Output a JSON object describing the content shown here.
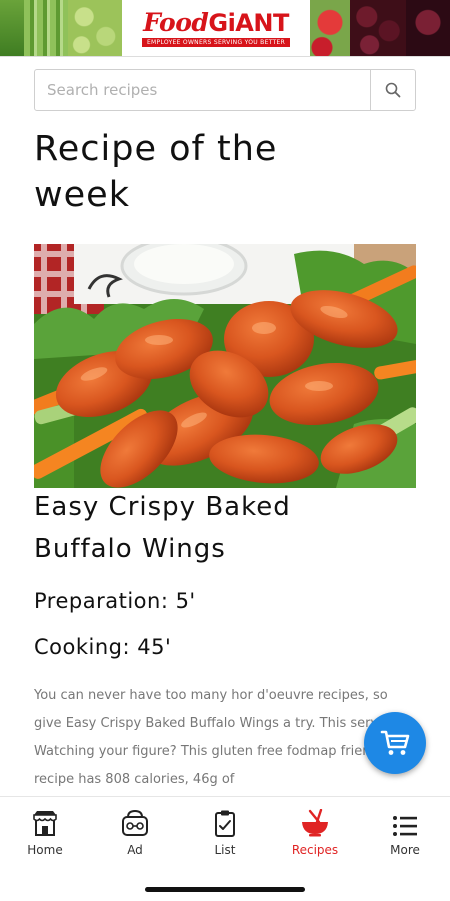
{
  "header": {
    "logo_text_part1": "Food",
    "logo_text_part2": "GiANT",
    "logo_tagline": "EMPLOYEE OWNERS SERVING YOU BETTER"
  },
  "search": {
    "placeholder": "Search recipes",
    "value": ""
  },
  "main": {
    "section_title": "Recipe of the week",
    "recipe": {
      "name": "Easy Crispy Baked Buffalo Wings",
      "preparation": "Preparation: 5'",
      "cooking": "Cooking: 45'",
      "description": "You can never have too many hor d'oeuvre recipes, so give Easy Crispy Baked Buffalo Wings a try. This serves 2. Watching your figure? This gluten free fodmap friendly recipe has 808 calories, 46g of"
    }
  },
  "fab": {
    "icon": "cart-icon",
    "color": "#1e88e5"
  },
  "bottom_nav": {
    "items": [
      {
        "label": "Home",
        "icon": "store-icon",
        "active": false
      },
      {
        "label": "Ad",
        "icon": "ad-icon",
        "active": false
      },
      {
        "label": "List",
        "icon": "clipboard-icon",
        "active": false
      },
      {
        "label": "Recipes",
        "icon": "bowl-icon",
        "active": true
      },
      {
        "label": "More",
        "icon": "menu-icon",
        "active": false
      }
    ],
    "active_color": "#e02424"
  }
}
